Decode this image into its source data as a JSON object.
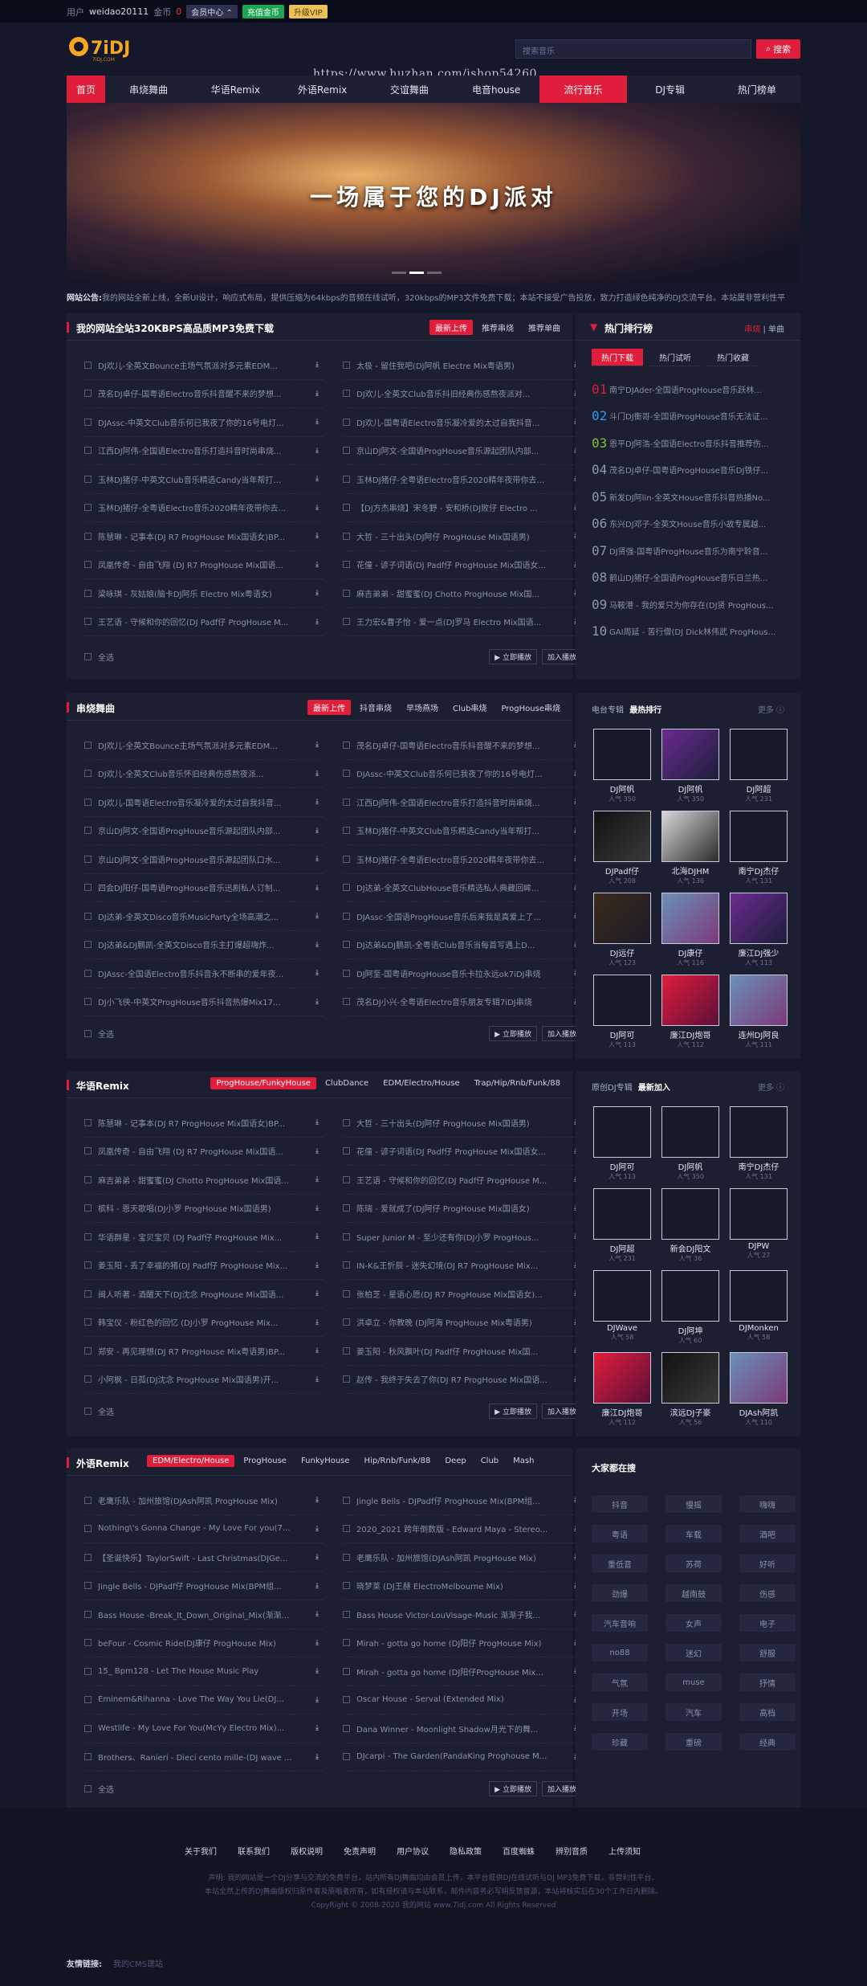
{
  "topbar": {
    "user_label": "用户",
    "username": "weidao20111",
    "coin_label": "金币",
    "coin_value": "0",
    "center": "会员中心",
    "charge": "充值金币",
    "vip": "升级VIP"
  },
  "logo": {
    "text": "7iDJ",
    "sub": "7iDJ.COM"
  },
  "watermark": "https://www.huzhan.com/ishop54260",
  "search": {
    "placeholder": "搜索音乐",
    "button": "搜索"
  },
  "nav": [
    "首页",
    "串烧舞曲",
    "华语Remix",
    "外语Remix",
    "交谊舞曲",
    "电音house",
    "流行音乐",
    "DJ专辑",
    "热门榜单"
  ],
  "banner": {
    "title": "一场属于您的DJ派对"
  },
  "notice": {
    "label": "网站公告:",
    "text": "我的网站全新上线，全新UI设计，响应式布局，提供压缩为64kbps的音频在线试听，320kbps的MP3文件免费下载；本站不接受广告投放，致力打造绿色纯净的DJ交流平台。本站属非营利性平"
  },
  "panel1": {
    "title": "我的网站全站320KBPS高品质MP3免费下载",
    "tabs": [
      "最新上传",
      "推荐串烧",
      "推荐单曲"
    ],
    "songs": [
      [
        "DJ欢儿-全英文Bounce主场气氛派对多元素EDM...",
        "太极 - 留住我吧(DJ阿帆 Electre Mix粤语男)"
      ],
      [
        "茂名DJ卓仔-国粤语Electro音乐抖音醒不来的梦想...",
        "DJ欢儿-全英文Club音乐抖旧经典伤感熬夜派对..."
      ],
      [
        "DJAssc-中英文Club音乐何已我夜了你的16号电灯...",
        "DJ欢儿-国粤语Electro音乐凝冷爱的太过自我抖音..."
      ],
      [
        "江西DJ阿伟-全国语Electro音乐打造抖音时尚串烧...",
        "京山DJ阿文-全国语ProgHouse音乐源起团队内部..."
      ],
      [
        "玉林DJ猪仔-中英文Club音乐精选Candy当年帮打...",
        "玉林DJ猪仔-全粤语Electro音乐2020精年夜带你去..."
      ],
      [
        "玉林DJ猪仔-全粤语Electro音乐2020精年夜带你去...",
        "【DJ方杰串烧】宋冬野 - 安和桥(DJ败仔 Electro ..."
      ],
      [
        "陈慧琳 - 记事本(DJ R7 ProgHouse Mix国语女)BP...",
        "大哲 - 三十出头(DJ阿仔 ProgHouse Mix国语男)"
      ],
      [
        "凤凰传奇 - 自由飞翔 (DJ R7 ProgHouse Mix国语...",
        "花僮 - 谚子词语(DJ Padf仔 ProgHouse Mix国语女..."
      ],
      [
        "梁咏琪 - 灰姑娘(脑卡DJ阿乐 Electro Mix粤语女)",
        "麻吉弟弟 - 甜蜜蜜(DJ Chotto ProgHouse Mix国..."
      ],
      [
        "王艺语 - 守候和你的回忆(DJ Padf仔 ProgHouse M...",
        "王力宏&曹子怡 - 爱一点(DJ罗马 Electro Mix国语..."
      ]
    ]
  },
  "hot": {
    "title": "热门排行榜",
    "links": [
      "串烧",
      "单曲"
    ],
    "tabs": [
      "热门下载",
      "热门试听",
      "热门收藏"
    ],
    "items": [
      "南宁DJAder-全国语ProgHouse音乐跃林...",
      "斗门DJ衡哥-全国语ProgHouse音乐无法证...",
      "恩平DJ阿浩-全国语Electro音乐抖音推荐伤...",
      "茂名DJ卓仔-国粤语ProgHouse音乐DJ铁仔...",
      "新发DJ阿lin-全英文House音乐抖音热播No...",
      "东兴DJ邓子-全英文House音乐小故专属越...",
      "DJ贤强-国粤语ProgHouse音乐为南宁聆音...",
      "鹤山DJ猪仔-全国语ProgHouse音乐日兰热...",
      "马鞍港 - 我的爱只为你存在(DJ贤 ProgHous...",
      "GAI周延 - 苦行僧(DJ Dick林伟武 ProgHouse..."
    ]
  },
  "foot_labels": {
    "all": "全选",
    "play": "立即播放",
    "add": "加入播放"
  },
  "panel2": {
    "title": "串烧舞曲",
    "tabs": [
      "最新上传",
      "抖音串烧",
      "早场燕场",
      "Club串烧",
      "ProgHouse串烧"
    ],
    "songs": [
      [
        "DJ欢儿-全英文Bounce主场气氛派对多元素EDM...",
        "茂名DJ卓仔-国粤语Electro音乐抖音醒不来的梦想..."
      ],
      [
        "DJ欢儿-全英文Club音乐怀旧经典伤感熬夜派...",
        "DJAssc-中英文Club音乐何已我夜了你的16号电灯..."
      ],
      [
        "DJ欢儿-国粤语Electro音乐凝冷爱的太过自我抖音...",
        "江西DJ阿伟-全国语Electro音乐打造抖音时尚串烧..."
      ],
      [
        "京山DJ阿文-全国语ProgHouse音乐源起团队内部...",
        "玉林DJ猪仔-中英文Club音乐精选Candy当年帮打..."
      ],
      [
        "京山DJ阿文-全国语ProgHouse音乐源起团队口水...",
        "玉林DJ猪仔-全粤语Electro音乐2020精年夜带你去..."
      ],
      [
        "四会DJ阳仔-国粤语ProgHouse音乐迅剧私人订制...",
        "DJ达弟-全英文ClubHouse音乐精选私人典藏回眸..."
      ],
      [
        "DJ达弟-全英文Disco音乐MusicParty全场高潮之...",
        "DJAssc-全国语ProgHouse音乐后来我是真爱上了..."
      ],
      [
        "DJ达弟&DJ鹏凯-全英文Disco音乐主打爆超嗨炸...",
        "DJ达弟&DJ鹏凯-全粤语Club音乐当每首写遇上D..."
      ],
      [
        "DJAssc-全国语Electro音乐抖音永不断串的爱年夜...",
        "DJ阿至-国粤语ProgHouse音乐卡拉永远ok7iDJ串烧"
      ],
      [
        "DJ小飞侠-中英文ProgHouse音乐抖音热爆Mix17...",
        "茂名DJ小兴-全粤语Electro音乐朋友专辑7iDJ串烧"
      ]
    ]
  },
  "album1": {
    "label": "电台专辑",
    "title": "最热排行",
    "more": "更多",
    "items": [
      {
        "name": "DJ阿帆",
        "hot": "人气 350"
      },
      {
        "name": "DJ阿帆",
        "hot": "人气 350"
      },
      {
        "name": "DJ阿超",
        "hot": "人气 231"
      },
      {
        "name": "DJPadf仔",
        "hot": "人气 208"
      },
      {
        "name": "北海DJHM",
        "hot": "人气 136"
      },
      {
        "name": "南宁DJ杰仔",
        "hot": "人气 131"
      },
      {
        "name": "DJ远仔",
        "hot": "人气 123"
      },
      {
        "name": "DJ康仔",
        "hot": "人气 116"
      },
      {
        "name": "廉江DJ强少",
        "hot": "人气 113"
      },
      {
        "name": "DJ阿可",
        "hot": "人气 113"
      },
      {
        "name": "廉江DJ炮哥",
        "hot": "人气 112"
      },
      {
        "name": "连州DJ阿良",
        "hot": "人气 111"
      }
    ]
  },
  "panel3": {
    "title": "华语Remix",
    "tabs": [
      "ProgHouse/FunkyHouse",
      "ClubDance",
      "EDM/Electro/House",
      "Trap/Hip/Rnb/Funk/88"
    ],
    "songs": [
      [
        "陈慧琳 - 记事本(DJ R7 ProgHouse Mix国语女)BP...",
        "大哲 - 三十出头(DJ阿仔 ProgHouse Mix国语男)"
      ],
      [
        "凤凰传奇 - 自由飞翔 (DJ R7 ProgHouse Mix国语...",
        "花僮 - 谚子词语(DJ Padf仔 ProgHouse Mix国语女..."
      ],
      [
        "麻吉弟弟 - 甜蜜蜜(DJ Chotto ProgHouse Mix国语...",
        "王艺语 - 守候和你的回忆(DJ Padf仔 ProgHouse M..."
      ],
      [
        "槟科 - 恩天歌唱(DJ小罗 ProgHouse Mix国语男)",
        "陈瑞 - 爱就成了(DJ阿仔 ProgHouse Mix国语女)"
      ],
      [
        "华语群星 - 宝贝宝贝 (DJ Padf仔 ProgHouse Mix...",
        "Super Junior M - 至少还有你(DJ小罗 ProgHous..."
      ],
      [
        "姜玉阳 - 丢了幸福的猪(DJ Padf仔 ProgHouse Mix...",
        "IN-K&王忻辰 - 迷失幻境(DJ R7 ProgHouse Mix..."
      ],
      [
        "闽人听著 - 酒醒天下(DJ沈念 ProgHouse Mix国语...",
        "张柏芝 - 星语心愿(DJ R7 ProgHouse Mix国语女)..."
      ],
      [
        "韩宝仪 - 粉红色的回忆 (DJ小罗 ProgHouse Mix...",
        "洪卓立 - 你教晚 (DJ阿海 ProgHouse Mix粤语男)"
      ],
      [
        "郑安 - 再见理想(DJ R7 ProgHouse Mix粤语男)BP...",
        "姜玉阳 - 秋风飘叶(DJ Padf仔 ProgHouse Mix国..."
      ],
      [
        "小阿枫 - 日孤(DJ沈念 ProgHouse Mix国语男)开...",
        "赵传 - 我终于失去了你(DJ R7 ProgHouse Mix国语..."
      ]
    ]
  },
  "album2": {
    "label": "原创DJ专辑",
    "title": "最新加入",
    "more": "更多",
    "items": [
      {
        "name": "DJ阿可",
        "hot": "人气 113"
      },
      {
        "name": "DJ阿帆",
        "hot": "人气 350"
      },
      {
        "name": "南宁DJ杰仔",
        "hot": "人气 131"
      },
      {
        "name": "DJ阿超",
        "hot": "人气 231"
      },
      {
        "name": "新会DJ阳文",
        "hot": "人气 36"
      },
      {
        "name": "DJPW",
        "hot": "人气 27"
      },
      {
        "name": "DJWave",
        "hot": "人气 58"
      },
      {
        "name": "DJ阿坤",
        "hot": "人气 60"
      },
      {
        "name": "DJMonken",
        "hot": "人气 58"
      },
      {
        "name": "廉江DJ炮哥",
        "hot": "人气 112"
      },
      {
        "name": "滨远DJ子豪",
        "hot": "人气 56"
      },
      {
        "name": "DJAsh阿凯",
        "hot": "人气 110"
      }
    ]
  },
  "panel4": {
    "title": "外语Remix",
    "tabs": [
      "EDM/Electro/House",
      "ProgHouse",
      "FunkyHouse",
      "Hip/Rnb/Funk/88",
      "Deep",
      "Club",
      "Mash"
    ],
    "songs": [
      [
        "老鹰乐队 - 加州旅馆(DJAsh阿凯 ProgHouse Mix)",
        "Jingle Bells - DJPadf仔 ProgHouse Mix(BPM组..."
      ],
      [
        "Nothing\\'s Gonna Change - My Love For you(7...",
        "2020_2021 跨年倒数版 - Edward Maya - Stereo..."
      ],
      [
        "【圣诞快乐】TaylorSwift - Last Christmas(DJGe...",
        "老鹰乐队 - 加州旅馆(DJAsh阿凯 ProgHouse Mix)"
      ],
      [
        "Jingle Bells - DJPadf仔 ProgHouse Mix(BPM组...",
        "晓梦莱 (DJ王赫 ElectroMelbourne Mix)"
      ],
      [
        "Bass House -Break_It_Down_Original_Mix(渐渐...",
        "Bass House Victor-LouVisage-Music 渐渐子我..."
      ],
      [
        "beFour - Cosmic Ride(DJ康仔 ProgHouse Mix)",
        "Mirah - gotta go home (DJ阳仔 ProgHouse Mix)"
      ],
      [
        "15_ Bpm128 - Let The House Music Play",
        "Mirah - gotta go home (DJ阳仔ProgHouse Mix..."
      ],
      [
        "Eminem&Rihanna - Love The Way You Lie(DJ...",
        "Oscar House - Serval (Extended Mix)"
      ],
      [
        "Westlife - My Love For You(McYy Electro Mix)...",
        "Dana Winner - Moonlight Shadow月光下的舞..."
      ],
      [
        "Brothers、Ranieri - Dieci cento mille-(DJ wave ...",
        "DJcarpi - The Garden(PandaKing Proghouse M..."
      ]
    ]
  },
  "tags": {
    "title": "大家都在搜",
    "items": [
      "抖音",
      "慢摇",
      "嗨嗨",
      "粤语",
      "车载",
      "酒吧",
      "重低音",
      "苏荷",
      "好听",
      "劲爆",
      "越南鼓",
      "伤感",
      "汽车音响",
      "女声",
      "电子",
      "no88",
      "迷幻",
      "舒服",
      "气氛",
      "muse",
      "抒情",
      "开场",
      "汽车",
      "高档",
      "珍藏",
      "重磅",
      "经典"
    ]
  },
  "footer": {
    "links": [
      "关于我们",
      "联系我们",
      "版权说明",
      "免责声明",
      "用户协议",
      "隐私政策",
      "百度蜘蛛",
      "辨别音质",
      "上传须知"
    ],
    "line1": "声明: 我的网站是一个DJ分享与交流的免费平台，站内所有DJ舞曲均由会员上传，本平台提供DJ在线试听与DJ MP3免费下载，非营利性平台。",
    "line2": "本站全然上传的DJ舞曲版权归原作者及原唱者所有，如有侵权请与本站联系，邮件内容务必写明反馈音源，本站将核实后在30个工作日内删除。",
    "line3": "CopyRight © 2008-2020 我的网站 www.7idj.com All Rights Reserved",
    "friend_label": "友情链接:",
    "friend_item": "我的CMS建站"
  }
}
